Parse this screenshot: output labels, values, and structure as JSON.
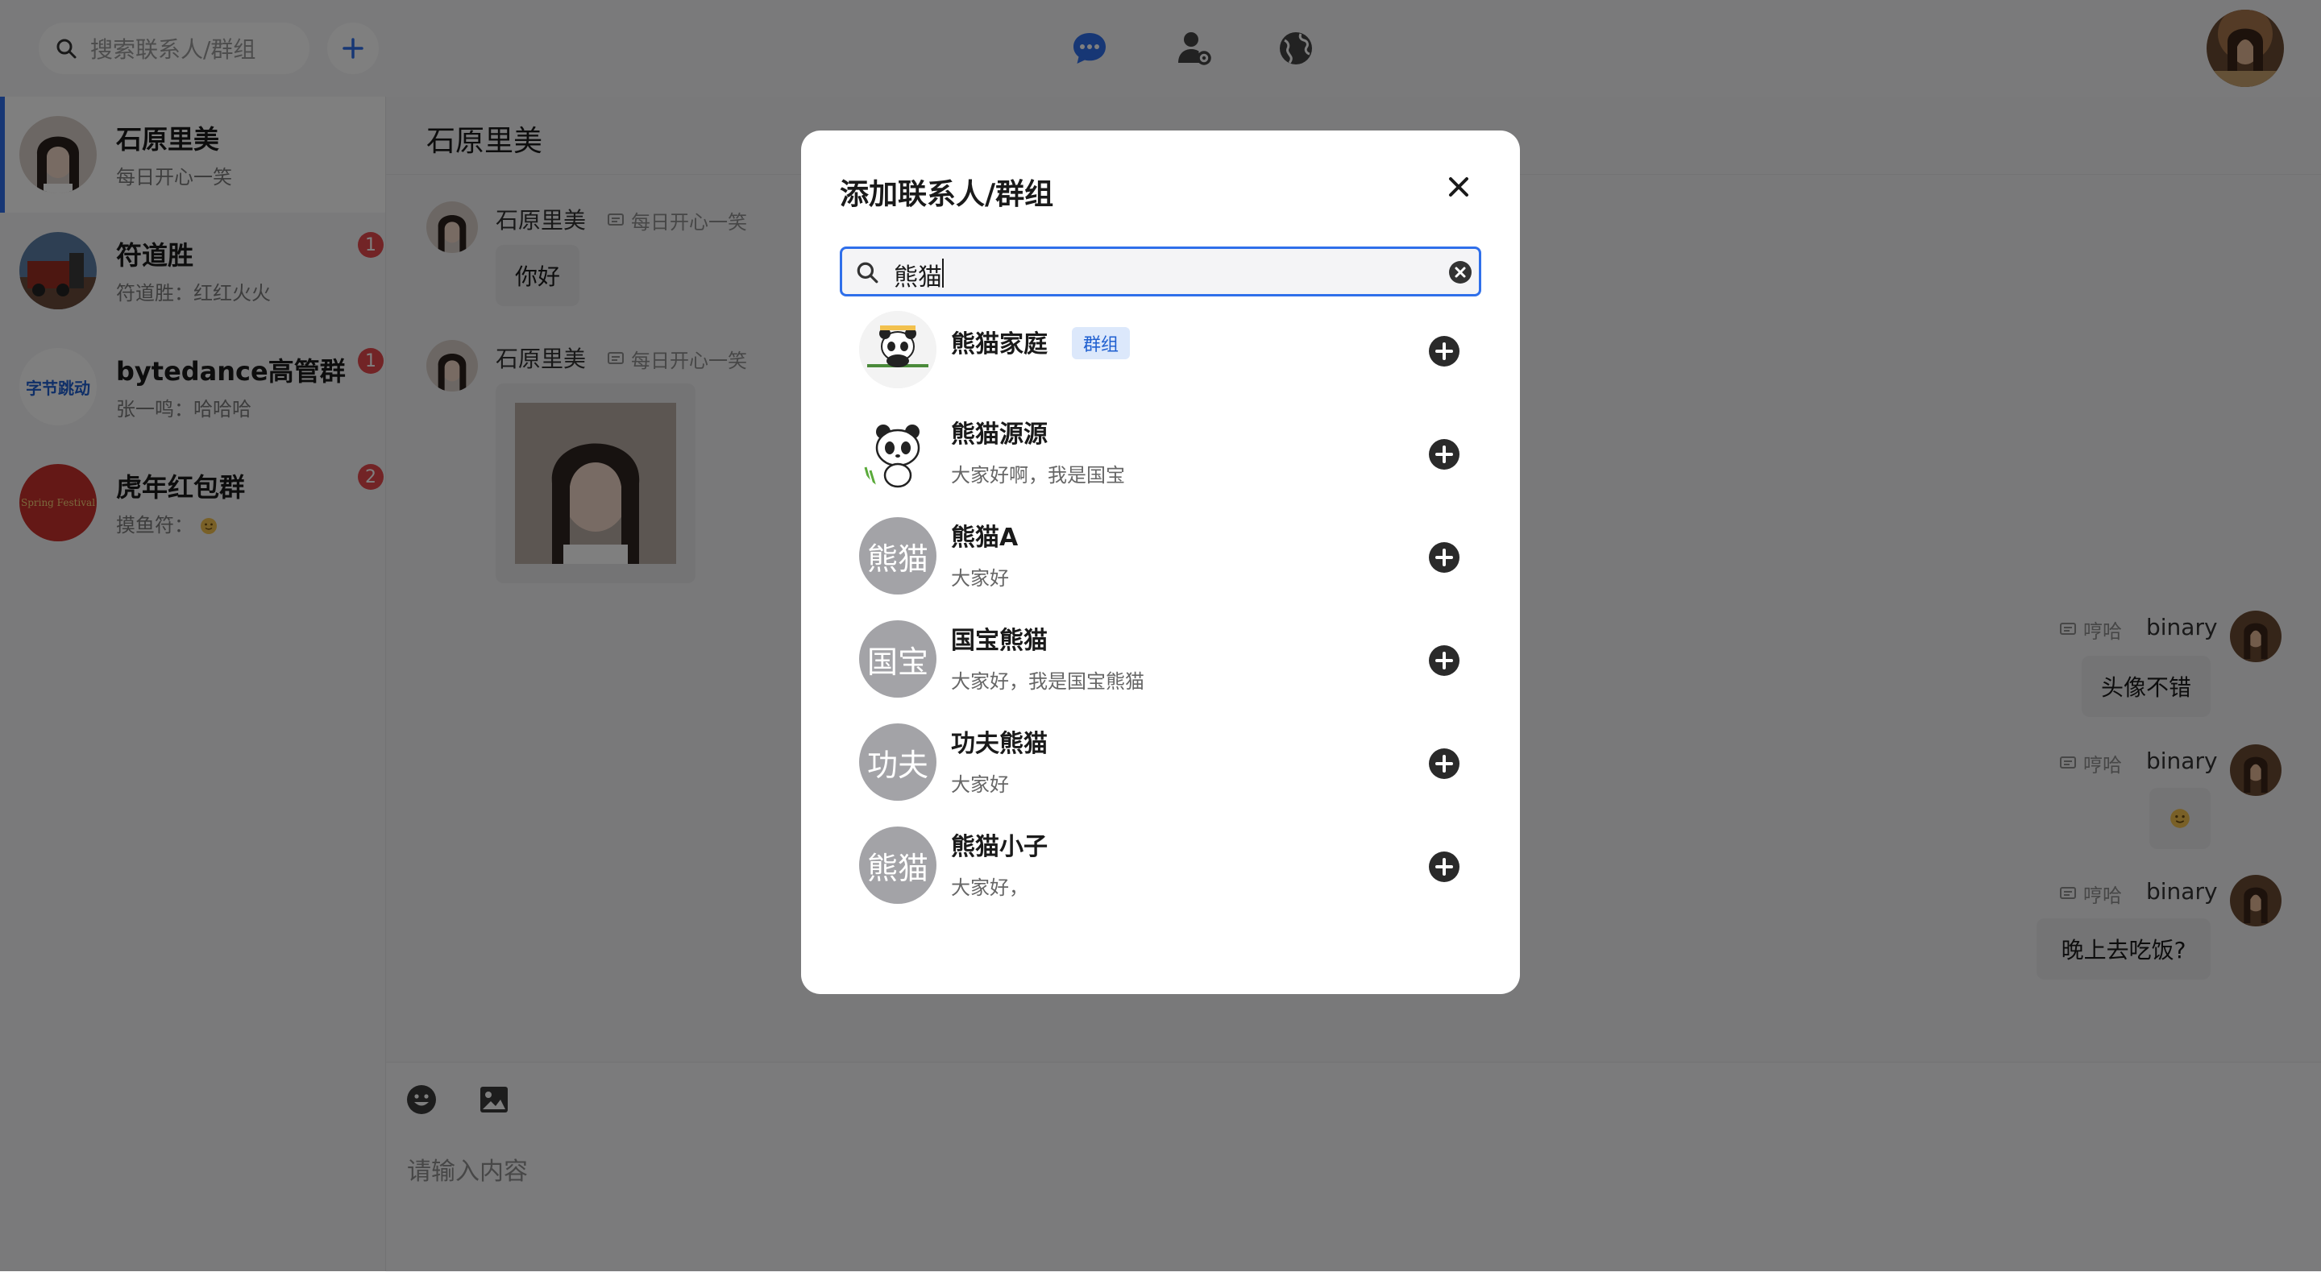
{
  "colors": {
    "accent": "#2f6fea",
    "badge": "#e5484d",
    "overlay": "rgba(0,0,0,0.5)",
    "tag_bg": "#dce8fb",
    "tag_text": "#1f5fd0"
  },
  "topbar": {
    "search_placeholder": "搜索联系人/群组",
    "icons": [
      "chat-bubble-icon",
      "contact-settings-icon",
      "globe-icon"
    ]
  },
  "sidebar": {
    "conversations": [
      {
        "name": "石原里美",
        "preview": "每日开心一笑",
        "active": true,
        "badge": ""
      },
      {
        "name": "符道胜",
        "preview": "符道胜：红红火火",
        "active": false,
        "badge": "1"
      },
      {
        "name": "bytedance高管群",
        "preview": "张一鸣：哈哈哈",
        "active": false,
        "badge": "1",
        "logo_text": "字节跳动"
      },
      {
        "name": "虎年红包群",
        "preview": "摸鱼符：",
        "active": false,
        "badge": "2",
        "logo_text": "Spring Festival"
      }
    ]
  },
  "chat": {
    "title": "石原里美",
    "messages": [
      {
        "sender": "石原里美",
        "meta": "每日开心一笑",
        "text": "你好"
      },
      {
        "sender": "石原里美",
        "meta": "每日开心一笑",
        "text": ""
      },
      {
        "sender": "binary",
        "meta": "哼哈",
        "text": "头像不错"
      },
      {
        "sender": "binary",
        "meta": "哼哈",
        "text": ""
      },
      {
        "sender": "binary",
        "meta": "哼哈",
        "text": "晚上去吃饭?"
      }
    ],
    "composer_placeholder": "请输入内容"
  },
  "modal": {
    "title": "添加联系人/群组",
    "search_value": "熊猫",
    "results": [
      {
        "name": "熊猫家庭",
        "desc": "",
        "tag": "群组",
        "avatar_text": ""
      },
      {
        "name": "熊猫源源",
        "desc": "大家好啊，我是国宝",
        "tag": "",
        "avatar_text": ""
      },
      {
        "name": "熊猫A",
        "desc": "大家好",
        "tag": "",
        "avatar_text": "熊猫"
      },
      {
        "name": "国宝熊猫",
        "desc": "大家好，我是国宝熊猫",
        "tag": "",
        "avatar_text": "国宝"
      },
      {
        "name": "功夫熊猫",
        "desc": "大家好",
        "tag": "",
        "avatar_text": "功夫"
      },
      {
        "name": "熊猫小子",
        "desc": "大家好，",
        "tag": "",
        "avatar_text": "熊猫"
      }
    ]
  }
}
